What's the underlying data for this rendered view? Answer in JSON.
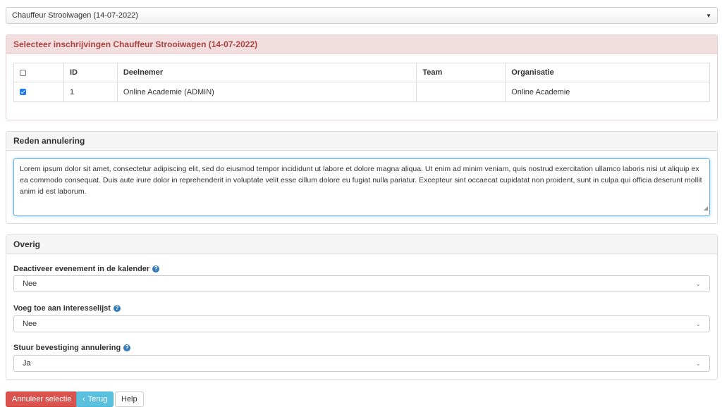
{
  "event_select": {
    "value": "Chauffeur Strooiwagen (14-07-2022)",
    "caret_icon": "caret-down-icon"
  },
  "registrations": {
    "title": "Selecteer inschrijvingen Chauffeur Strooiwagen (14-07-2022)",
    "columns": {
      "id": "ID",
      "participant": "Deelnemer",
      "team": "Team",
      "organisation": "Organisatie"
    },
    "rows": [
      {
        "checked": true,
        "id": "1",
        "participant": "Online Academie (ADMIN)",
        "team": "",
        "organisation": "Online Academie"
      }
    ]
  },
  "reason": {
    "title": "Reden annulering",
    "text": "Lorem ipsum dolor sit amet, consectetur adipiscing elit, sed do eiusmod tempor incididunt ut labore et dolore magna aliqua. Ut enim ad minim veniam, quis nostrud exercitation ullamco laboris nisi ut aliquip ex ea commodo consequat. Duis aute irure dolor in reprehenderit in voluptate velit esse cillum dolore eu fugiat nulla pariatur. Excepteur sint occaecat cupidatat non proident, sunt in culpa qui officia deserunt mollit anim id est laborum."
  },
  "other": {
    "title": "Overig",
    "deactivate": {
      "label": "Deactiveer evenement in de kalender",
      "value": "Nee"
    },
    "interest_list": {
      "label": "Voeg toe aan interesselijst",
      "value": "Nee"
    },
    "send_confirmation": {
      "label": "Stuur bevestiging annulering",
      "value": "Ja"
    }
  },
  "buttons": {
    "cancel_selection": "Annuleer selectie",
    "back": "Terug",
    "help": "Help"
  },
  "colors": {
    "danger": "#d9534f",
    "info": "#5bc0de",
    "help_icon": "#337ab7"
  }
}
